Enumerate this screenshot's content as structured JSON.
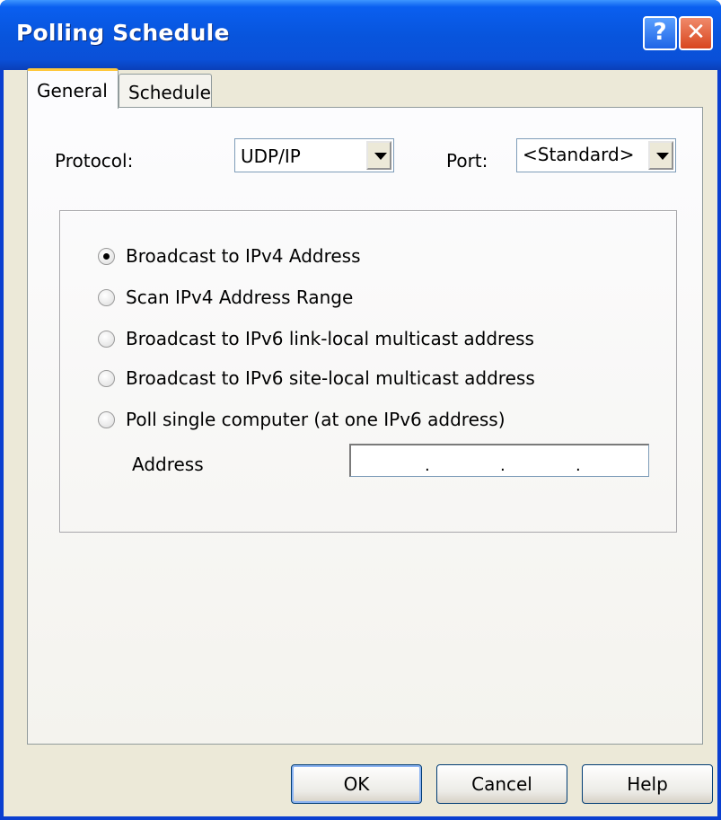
{
  "window": {
    "title": "Polling Schedule"
  },
  "titlebar": {
    "help_glyph": "?",
    "close_glyph": "✕"
  },
  "tabs": [
    {
      "label": "General",
      "active": true
    },
    {
      "label": "Schedule",
      "active": false
    }
  ],
  "general": {
    "protocol_label": "Protocol:",
    "protocol_value": "UDP/IP",
    "port_label": "Port:",
    "port_value": "<Standard>",
    "radio_options": [
      {
        "label": "Broadcast to IPv4 Address",
        "selected": true
      },
      {
        "label": "Scan IPv4 Address Range",
        "selected": false
      },
      {
        "label": "Broadcast to IPv6 link-local multicast address",
        "selected": false
      },
      {
        "label": "Broadcast to IPv6 site-local multicast address",
        "selected": false
      },
      {
        "label": "Poll single computer (at one IPv6 address)",
        "selected": false
      }
    ],
    "address_label": "Address",
    "address_value": ". . ."
  },
  "footer": {
    "ok_label": "OK",
    "cancel_label": "Cancel",
    "help_label": "Help"
  },
  "colors": {
    "titlebar_blue": "#0855dd",
    "window_face": "#ece9d8",
    "tab_highlight": "#ffc83c",
    "close_red": "#d8461e"
  }
}
